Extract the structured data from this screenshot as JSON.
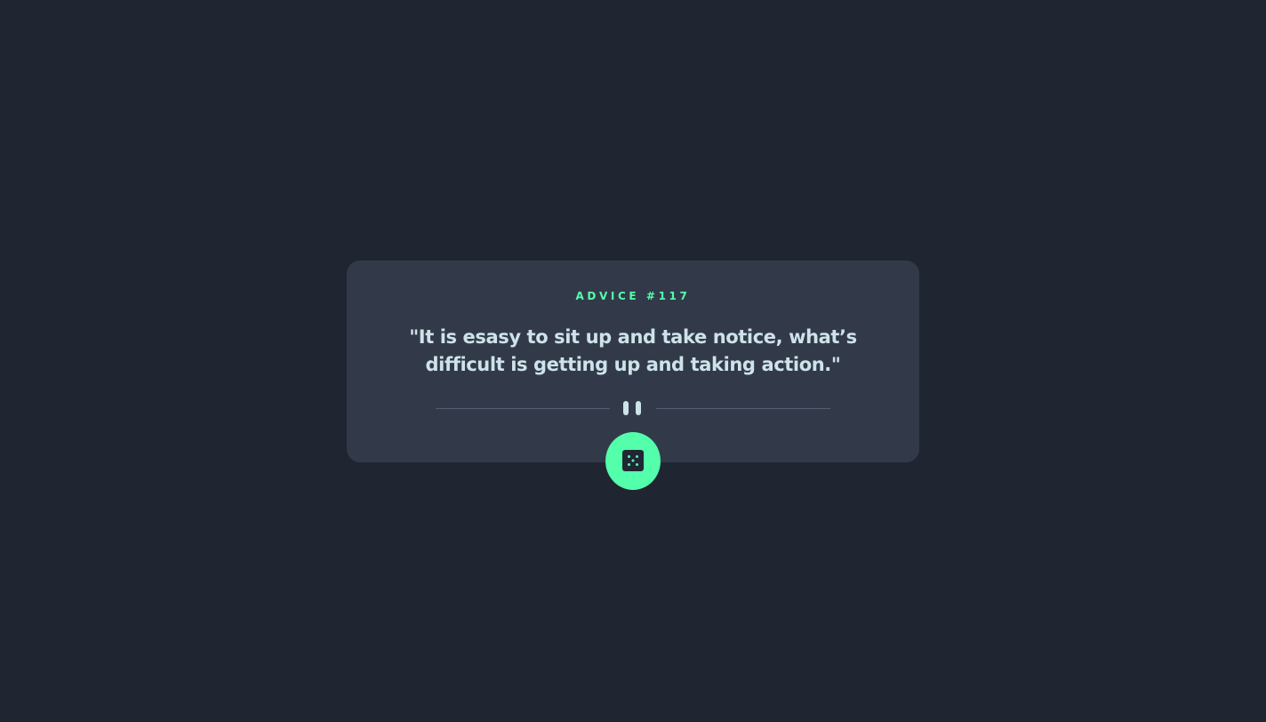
{
  "advice": {
    "label": "ADVICE #117",
    "quote": "\"It is esasy to sit up and take notice, what’s difficult is getting up and taking action.\""
  },
  "icons": {
    "divider": "pause-icon",
    "button": "dice-icon"
  },
  "colors": {
    "background": "#1f2632",
    "card": "#323a4a",
    "accent": "#53ffaa",
    "text": "#cee3e9",
    "divider": "#4f5d74"
  }
}
